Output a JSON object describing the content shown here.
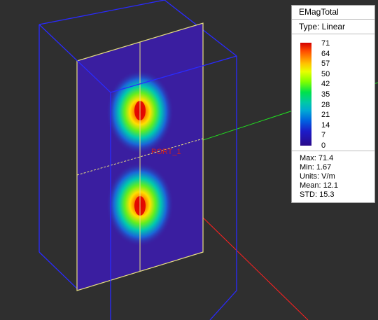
{
  "legend": {
    "title": "EMagTotal",
    "type_label": "Type: Linear",
    "ticks": [
      "71",
      "64",
      "57",
      "50",
      "42",
      "35",
      "28",
      "21",
      "14",
      "7",
      "0"
    ],
    "stats": {
      "max": "Max: 71.4",
      "min": "Min: 1.67",
      "units": "Units: V/m",
      "mean": "Mean: 12.1",
      "std": "STD: 15.3"
    }
  },
  "port_label": "PORT_1",
  "colors": {
    "background": "#2f2f2f",
    "box_edges": "#2a2aff",
    "plane_outline": "#e8e080",
    "field_low": "#2a0a8a",
    "field_high": "#e00000",
    "axis_x": "#ff2020",
    "axis_y": "#20e020",
    "port_label": "#cc2020"
  }
}
